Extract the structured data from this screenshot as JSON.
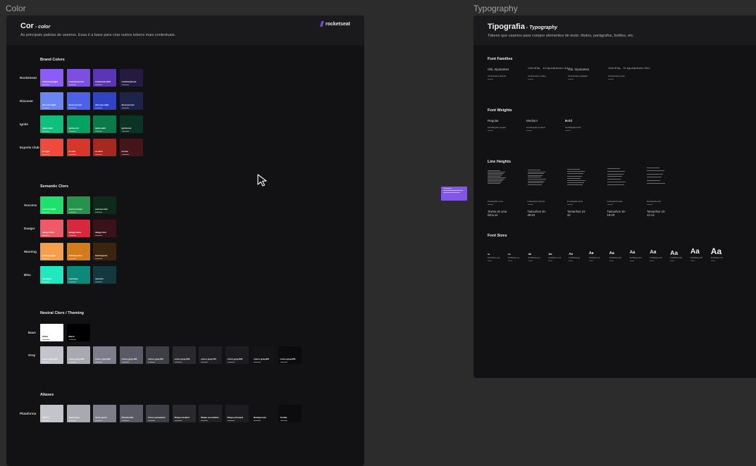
{
  "frames": {
    "color_label": "Color",
    "typography_label": "Typography"
  },
  "color_board": {
    "title": "Cor",
    "title_suffix": " - color",
    "subtitle": "As principais paletas de usamos. Essa é a base para criar outros tokens mais contextuais.",
    "logo_text": "rocketseat",
    "sections": {
      "brand": "Brand Colors",
      "semantic": "Semantic Clors",
      "neutral": "Neutral Clors / Theming",
      "aliases": "Aliases"
    },
    "brand_rows": [
      {
        "label": "Rocketseat",
        "swatches": [
          {
            "name": "rocketseat.light",
            "color": "#8b5cf6"
          },
          {
            "name": "rocketseat.mid",
            "color": "#7c4ee4"
          },
          {
            "name": "rocketseat.dark",
            "color": "#5b36b4"
          },
          {
            "name": "rocketseat.low",
            "color": "#241a42"
          }
        ]
      },
      {
        "label": "Discover",
        "swatches": [
          {
            "name": "discover.light",
            "color": "#6a86f5"
          },
          {
            "name": "discover.mid",
            "color": "#4b61e8"
          },
          {
            "name": "discover.dark",
            "color": "#2f43c4"
          },
          {
            "name": "discover.low",
            "color": "#1e234a"
          }
        ]
      },
      {
        "label": "Ignite",
        "swatches": [
          {
            "name": "ignite.light",
            "color": "#0fc07c"
          },
          {
            "name": "ignite.mid",
            "color": "#04a361"
          },
          {
            "name": "ignite.dark",
            "color": "#0a7a4a"
          },
          {
            "name": "ignite.low",
            "color": "#0c3424"
          }
        ]
      },
      {
        "label": "Experts Club",
        "swatches": [
          {
            "name": "ec.light",
            "color": "#ef4a3c"
          },
          {
            "name": "ec.mid",
            "color": "#d7362b"
          },
          {
            "name": "ec.dark",
            "color": "#a8271f"
          },
          {
            "name": "ec.low",
            "color": "#44161a"
          }
        ]
      }
    ],
    "semantic_rows": [
      {
        "label": "Success",
        "swatches": [
          {
            "name": "success.light",
            "color": "#1ee06a"
          },
          {
            "name": "success.base",
            "color": "#25934a"
          },
          {
            "name": "success.low",
            "color": "#0f2a19"
          }
        ]
      },
      {
        "label": "Danger",
        "swatches": [
          {
            "name": "danger.light",
            "color": "#f05a67"
          },
          {
            "name": "danger.base",
            "color": "#d8283d"
          },
          {
            "name": "danger.low",
            "color": "#3a121a"
          }
        ]
      },
      {
        "label": "Warning",
        "swatches": [
          {
            "name": "warning.light",
            "color": "#f59f4b"
          },
          {
            "name": "warning.base",
            "color": "#d47b1c"
          },
          {
            "name": "warning.low",
            "color": "#3b2511"
          }
        ]
      },
      {
        "label": "Bleu",
        "swatches": [
          {
            "name": "new.light",
            "color": "#22e8c0"
          },
          {
            "name": "new.base",
            "color": "#0b8a7a"
          },
          {
            "name": "new.low",
            "color": "#13393e"
          }
        ]
      }
    ],
    "base_row": {
      "label": "Base",
      "swatches": [
        {
          "name": "White",
          "color": "#ffffff"
        },
        {
          "name": "Black",
          "color": "#000000"
        }
      ]
    },
    "gray_row": {
      "label": "Gray",
      "swatches": [
        {
          "name": "colors.gray.100",
          "color": "#c4c4cc"
        },
        {
          "name": "colors.gray.200",
          "color": "#a9a9b2"
        },
        {
          "name": "colors.gray.300",
          "color": "#7c7c8a"
        },
        {
          "name": "colors.gray.400",
          "color": "#5a5a66"
        },
        {
          "name": "colors.gray.500",
          "color": "#3e3e47"
        },
        {
          "name": "colors.gray.600",
          "color": "#29292e"
        },
        {
          "name": "colors.gray.700",
          "color": "#202024"
        },
        {
          "name": "colors.gray.800",
          "color": "#1d1d21"
        },
        {
          "name": "colors.gray.900",
          "color": "#141417"
        },
        {
          "name": "colors.gray.950",
          "color": "#0c0c0e"
        }
      ]
    },
    "aliases_row": {
      "label": "Plataforma",
      "swatches": [
        {
          "name": "Títulos",
          "color": "#c4c4cc"
        },
        {
          "name": "Texto base",
          "color": "#a9a9b2"
        },
        {
          "name": "Texto apoio",
          "color": "#7c7c8a"
        },
        {
          "name": "Placeholder",
          "color": "#5a5a66"
        },
        {
          "name": "Ícone secundário",
          "color": "#3e3e47"
        },
        {
          "name": "Shape terciário",
          "color": "#29292e"
        },
        {
          "name": "Shape secundário",
          "color": "#202024"
        },
        {
          "name": "Shape principal",
          "color": "#1d1d21"
        },
        {
          "name": "Background",
          "color": "#121214"
        },
        {
          "name": "Tooltip",
          "color": "#0c0c0e"
        }
      ]
    }
  },
  "typography_board": {
    "title": "Tipografia",
    "title_suffix": " - Typography",
    "subtitle": "Tokens que usamos para compor elementos de texto: títulos, parágrafos, botões, etc.",
    "sections": {
      "families": "Font Families",
      "weights": "Font Weights",
      "line_heights": "Line Heights",
      "sizes": "Font Sizes"
    },
    "families": [
      {
        "sample": "Olá, tripulantes",
        "token": "fontFamilies.default",
        "mono": false
      },
      {
        "sample": "<h1>Olá, tripulantes</h1>",
        "token": "fontFamilies.coding",
        "mono": true
      },
      {
        "sample": "Olá, tripulantes",
        "token": "fontFamilies.highlight",
        "mono": false
      },
      {
        "sample": "<h1>Olá, tripulantes</h1>",
        "token": "fontFamilies.code",
        "mono": true
      }
    ],
    "weights": [
      {
        "label": "Regular",
        "token": "fontWeights.regular"
      },
      {
        "label": "Medium",
        "token": "fontWeights.medium"
      },
      {
        "label": "Bold",
        "token": "fontWeights.bold"
      }
    ],
    "line_heights": [
      {
        "token": "lineHeights.none",
        "caption": "Textos de uma linha só"
      },
      {
        "token": "lineHeights.shorter",
        "caption": "Tamanhos 40-48-64"
      },
      {
        "token": "lineHeights.short",
        "caption": "Tamanhos 24-32"
      },
      {
        "token": "lineHeights.base",
        "caption": "Tamanhos 16-18-20"
      },
      {
        "token": "lineHeights.tall",
        "caption": "Tamanhos 10-12-14"
      }
    ],
    "sizes": [
      {
        "label": "Aa",
        "token": "fontSizes.xxs"
      },
      {
        "label": "Aa",
        "token": "fontSizes.xs"
      },
      {
        "label": "Aa",
        "token": "fontSizes.sm"
      },
      {
        "label": "Aa",
        "token": "fontSizes.md"
      },
      {
        "label": "Aa",
        "token": "fontSizes.lg"
      },
      {
        "label": "Aa",
        "token": "fontSizes.xl"
      },
      {
        "label": "Aa",
        "token": "fontSizes.2xl"
      },
      {
        "label": "Aa",
        "token": "fontSizes.3xl"
      },
      {
        "label": "Aa",
        "token": "fontSizes.4xl"
      },
      {
        "label": "Aa",
        "token": "fontSizes.5xl"
      },
      {
        "label": "Aa",
        "token": "fontSizes.6xl"
      },
      {
        "label": "Aa",
        "token": "fontSizes.7xl"
      }
    ]
  },
  "sticky_note": {
    "color": "#8257e5"
  },
  "cursor": {
    "icon": "pointer-cursor-icon"
  }
}
